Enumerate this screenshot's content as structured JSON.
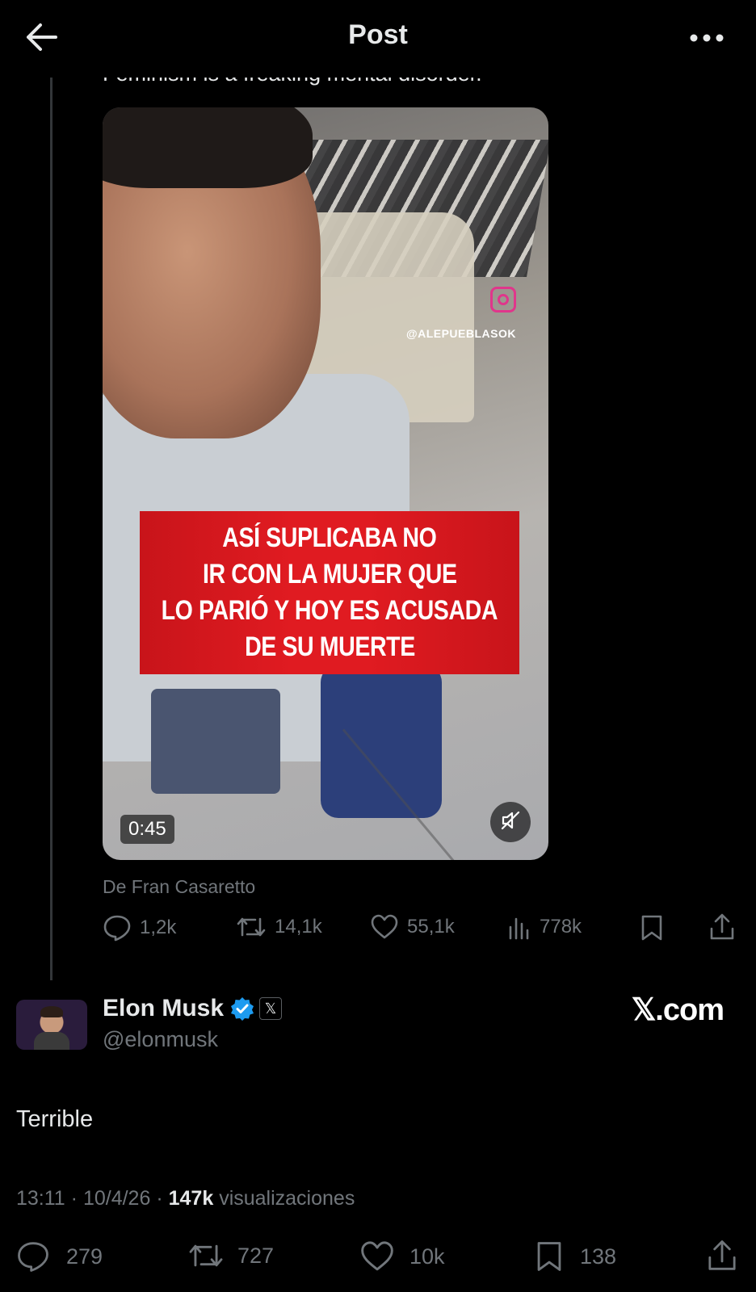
{
  "header": {
    "title": "Post",
    "back_icon": "arrow-left-icon",
    "more_icon": "more-horizontal-icon"
  },
  "quoted_post": {
    "text": "Feminism is a freaking mental disorder.",
    "media": {
      "overlay_handle": "@ALEPUEBLASOK",
      "banner_lines": [
        "ASÍ SUPLICABA NO",
        "IR CON LA MUJER QUE",
        "LO PARIÓ Y HOY ES ACUSADA",
        "DE SU MUERTE"
      ],
      "duration": "0:45",
      "banner_color": "#e01b21"
    },
    "source": "De Fran Casaretto",
    "actions": {
      "replies": "1,2k",
      "reposts": "14,1k",
      "likes": "55,1k",
      "views": "778k"
    }
  },
  "post": {
    "author": {
      "name": "Elon Musk",
      "handle": "@elonmusk",
      "verified_color": "#1d9bf0",
      "affiliate_badge": "𝕏"
    },
    "watermark": "𝕏.com",
    "text": "Terrible",
    "meta": {
      "time": "13:11",
      "date": "10/4/26",
      "views_count": "147k",
      "views_label": "visualizaciones"
    },
    "actions": {
      "replies": "279",
      "reposts": "727",
      "likes": "10k",
      "bookmarks": "138"
    }
  },
  "colors": {
    "background": "#000000",
    "text_primary": "#e7e9ea",
    "text_secondary": "#71767b"
  }
}
